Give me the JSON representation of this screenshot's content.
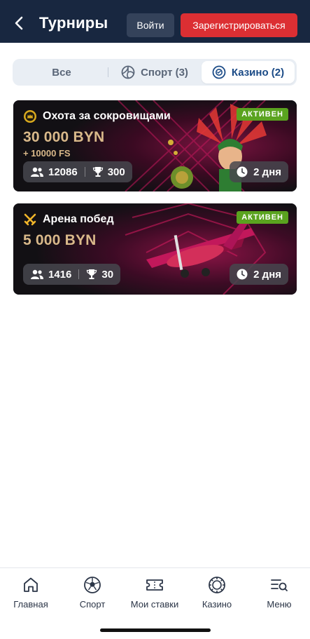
{
  "header": {
    "title": "Турниры",
    "login_label": "Войти",
    "register_label": "Зарегистрироваться"
  },
  "tabs": [
    {
      "label": "Все",
      "icon": "none",
      "active": false
    },
    {
      "label": "Спорт (3)",
      "icon": "volleyball-icon",
      "active": false
    },
    {
      "label": "Казино (2)",
      "icon": "casino-chip-icon",
      "active": true
    }
  ],
  "tournaments": [
    {
      "title": "Охота за сокровищами",
      "icon": "crown-coin-icon",
      "prize": "30 000 BYN",
      "extra": "+ 10000 FS",
      "status": "АКТИВЕН",
      "participants": "12086",
      "prizes_count": "300",
      "time_left": "2 дня"
    },
    {
      "title": "Арена побед",
      "icon": "crossed-swords-icon",
      "prize": "5 000 BYN",
      "status": "АКТИВЕН",
      "participants": "1416",
      "prizes_count": "30",
      "time_left": "2 дня"
    }
  ],
  "bottom_nav": [
    {
      "label": "Главная",
      "icon": "home-icon"
    },
    {
      "label": "Спорт",
      "icon": "soccer-ball-icon"
    },
    {
      "label": "Мои ставки",
      "icon": "ticket-icon"
    },
    {
      "label": "Казино",
      "icon": "casino-chip-icon"
    },
    {
      "label": "Меню",
      "icon": "menu-search-icon"
    }
  ],
  "colors": {
    "header_bg": "#182740",
    "register_red": "#dc2f33",
    "prize_gold": "#d9b98a",
    "status_green": "#5aa31f",
    "active_tab_blue": "#1a4a86"
  }
}
